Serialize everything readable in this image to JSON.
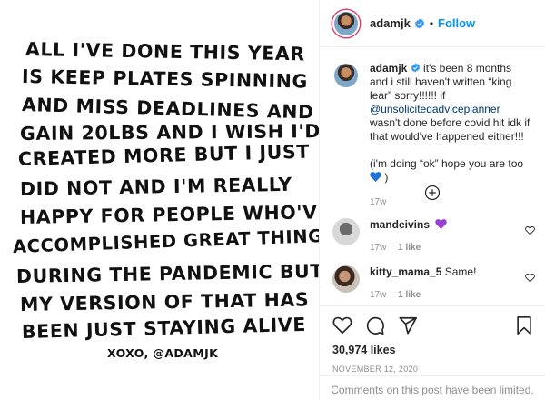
{
  "image": {
    "lines": [
      "ALL I'VE DONE THIS YEAR",
      "IS KEEP PLATES SPINNING",
      "AND MISS DEADLINES AND",
      "GAIN 20LBS AND I WISH I'D",
      "CREATED MORE BUT I JUST",
      "DID NOT AND I'M REALLY",
      "HAPPY FOR PEOPLE WHO'VE",
      "ACCOMPLISHED GREAT THINGS",
      "DURING THE PANDEMIC BUT",
      "MY VERSION OF THAT HAS",
      "BEEN JUST STAYING ALIVE"
    ],
    "signoff": "XOXO, @ADAMJK"
  },
  "header": {
    "username": "adamjk",
    "separator": "•",
    "follow_label": "Follow",
    "verified_icon": "verified-badge-icon",
    "accent_color": "#0095f6"
  },
  "caption": {
    "username": "adamjk",
    "text_1": "it's been 8 months and i still haven't written “king lear” sorry!!!!!! if",
    "mention": "@unsolicitedadviceplanner",
    "text_2": "wasn't done before covid hit idk if that would've happened either!!!",
    "text_3": "(i'm doing “ok” hope you are too",
    "text_3_end": ")",
    "emoji": "blue-heart-icon",
    "time": "17w"
  },
  "load_more_icon": "plus-circle-icon",
  "comments": [
    {
      "username": "mandeivins",
      "emoji": "purple-heart-icon",
      "text": "",
      "time": "17w",
      "likes": "1 like"
    },
    {
      "username": "kitty_mama_5",
      "emoji": "",
      "text": "Same!",
      "time": "17w",
      "likes": "1 like"
    }
  ],
  "actions": {
    "likes_count": "30,974 likes",
    "date": "NOVEMBER 12, 2020",
    "icons": [
      "heart-icon",
      "comment-icon",
      "share-icon",
      "bookmark-icon"
    ]
  },
  "footer": {
    "limited_text": "Comments on this post have been limited."
  }
}
